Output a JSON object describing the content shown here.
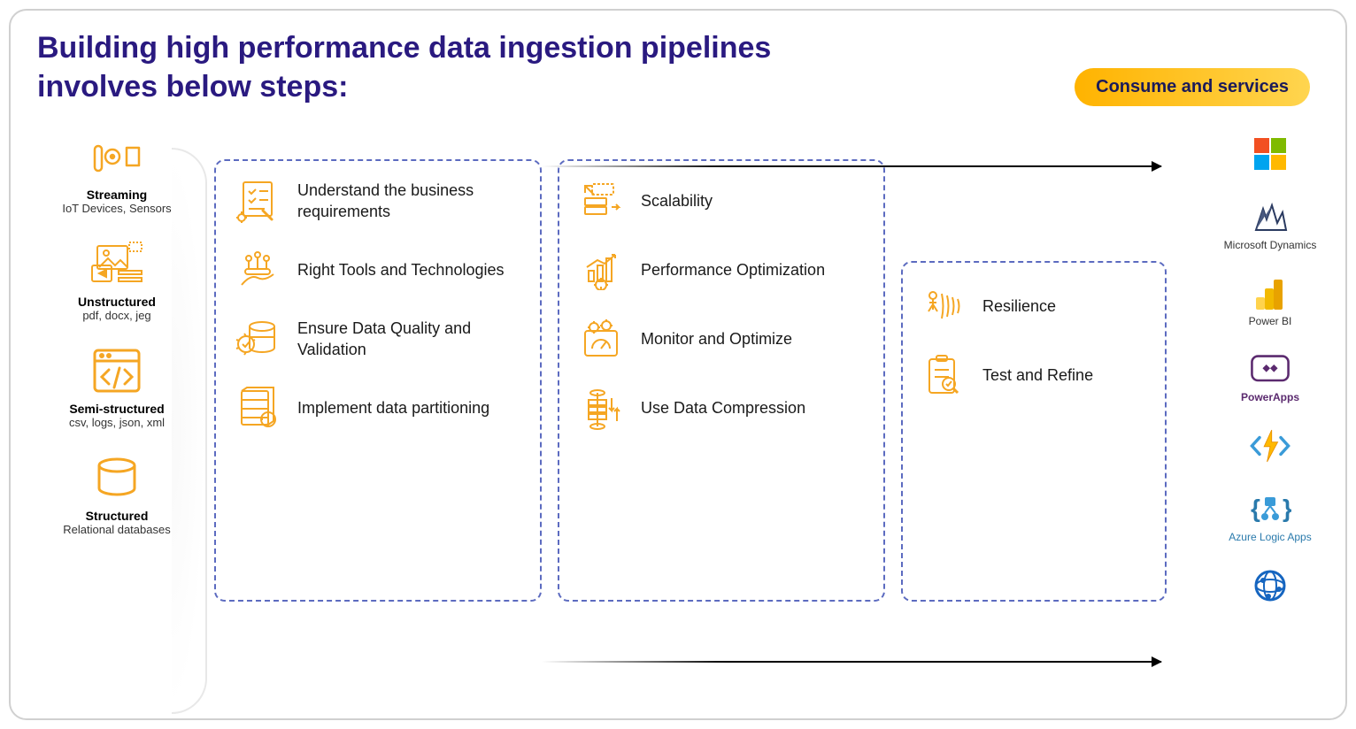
{
  "title": "Building high performance data ingestion pipelines involves below steps:",
  "badge": "Consume and services",
  "sources": [
    {
      "name": "iot-icon",
      "title": "Streaming",
      "sub": "IoT Devices, Sensors"
    },
    {
      "name": "media-icon",
      "title": "Unstructured",
      "sub": "pdf, docx, jeg"
    },
    {
      "name": "code-icon",
      "title": "Semi-structured",
      "sub": "csv, logs, json, xml"
    },
    {
      "name": "database-icon",
      "title": "Structured",
      "sub": "Relational databases"
    }
  ],
  "columns": [
    [
      "Understand the business requirements",
      "Right Tools and Technologies",
      "Ensure Data Quality and Validation",
      "Implement data partitioning"
    ],
    [
      "Scalability",
      "Performance Optimization",
      "Monitor and Optimize",
      "Use Data Compression"
    ],
    [
      "Resilience",
      "Test and Refine"
    ]
  ],
  "step_icons": [
    [
      "checklist-icon",
      "tools-hand-icon",
      "data-quality-icon",
      "partition-icon"
    ],
    [
      "scalability-icon",
      "perf-chart-icon",
      "monitor-gauge-icon",
      "compression-icon"
    ],
    [
      "resilience-icon",
      "test-clipboard-icon"
    ]
  ],
  "services": [
    {
      "name": "microsoft-icon",
      "label": ""
    },
    {
      "name": "dynamics-icon",
      "label": "Microsoft Dynamics"
    },
    {
      "name": "powerbi-icon",
      "label": "Power BI"
    },
    {
      "name": "powerapps-icon",
      "label": "PowerApps"
    },
    {
      "name": "functions-icon",
      "label": ""
    },
    {
      "name": "logicapps-icon",
      "label": "Azure Logic Apps"
    },
    {
      "name": "globe-icon",
      "label": ""
    }
  ],
  "colors": {
    "accent_orange": "#f5a623",
    "title_purple": "#2a1a80",
    "dash_blue": "#5c6bc0"
  }
}
